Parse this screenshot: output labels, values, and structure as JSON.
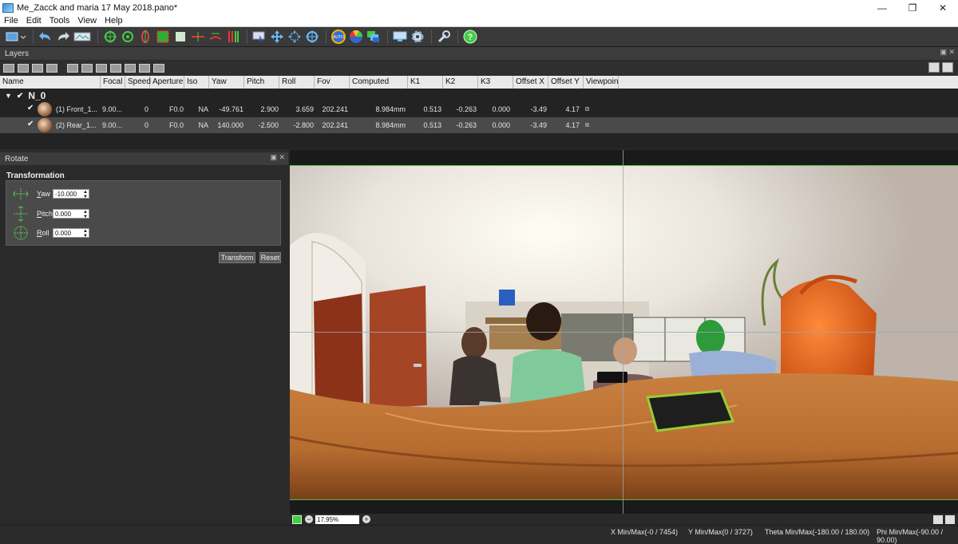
{
  "window": {
    "title": "Me_Zacck and maria 17 May 2018.pano*",
    "minimize": "—",
    "restore": "❐",
    "close": "✕"
  },
  "menu": [
    "File",
    "Edit",
    "Tools",
    "View",
    "Help"
  ],
  "toolbar_icons": [
    "monitor-dropdown-icon",
    "undo-icon",
    "redo-icon",
    "image-strip-icon",
    "target-green-icon",
    "target-cross-icon",
    "target-red-icon",
    "square-select-icon",
    "layer-icon",
    "horizon-icon",
    "vertical-lines-icon",
    "red-green-bars-icon",
    "select-cursor-icon",
    "move-arrows-icon",
    "move-grid-icon",
    "crosshair-icon",
    "auto-icon",
    "color-wheel-icon",
    "layers-color-icon",
    "screen-icon",
    "gear-icon",
    "wrench-icon",
    "help-icon"
  ],
  "layers": {
    "title": "Layers",
    "columns": [
      "Name",
      "Focal",
      "Speed",
      "Aperture",
      "Iso",
      "Yaw",
      "Pitch",
      "Roll",
      "Fov",
      "Computed focal",
      "K1",
      "K2",
      "K3",
      "Offset X",
      "Offset Y",
      "Viewpoin"
    ],
    "root": "N_0",
    "rows": [
      {
        "name": "(1) Front_1...",
        "focal": "9.00...",
        "speed": "0",
        "aperture": "F0.0",
        "iso": "NA",
        "yaw": "-49.761",
        "pitch": "2.900",
        "roll": "3.659",
        "fov": "202.241",
        "computed_focal": "8.984mm",
        "k1": "0.513",
        "k2": "-0.263",
        "k3": "0.000",
        "offset_x": "-3.49",
        "offset_y": "4.17",
        "selected": false
      },
      {
        "name": "(2) Rear_1...",
        "focal": "9.00...",
        "speed": "0",
        "aperture": "F0.0",
        "iso": "NA",
        "yaw": "140.000",
        "pitch": "-2.500",
        "roll": "-2.800",
        "fov": "202.241",
        "computed_focal": "8.984mm",
        "k1": "0.513",
        "k2": "-0.263",
        "k3": "0.000",
        "offset_x": "-3.49",
        "offset_y": "4.17",
        "selected": true
      }
    ]
  },
  "rotate": {
    "title": "Rotate",
    "section": "Transformation",
    "yaw": {
      "label_u": "Y",
      "label_rest": "aw",
      "value": "-10.000"
    },
    "pitch": {
      "label_u": "P",
      "label_rest": "itch",
      "value": "0.000"
    },
    "roll": {
      "label_u": "R",
      "label_rest": "oll",
      "value": "0.000"
    },
    "transform_label": "Transform",
    "reset_label": "Reset"
  },
  "viewer": {
    "zoom": "17.95%"
  },
  "status": {
    "x": "X Min/Max(-0 / 7454)",
    "y": "Y Min/Max(0 / 3727)",
    "theta": "Theta Min/Max(-180.00 / 180.00)",
    "phi": "Phi Min/Max(-90.00 / 90.00)"
  }
}
